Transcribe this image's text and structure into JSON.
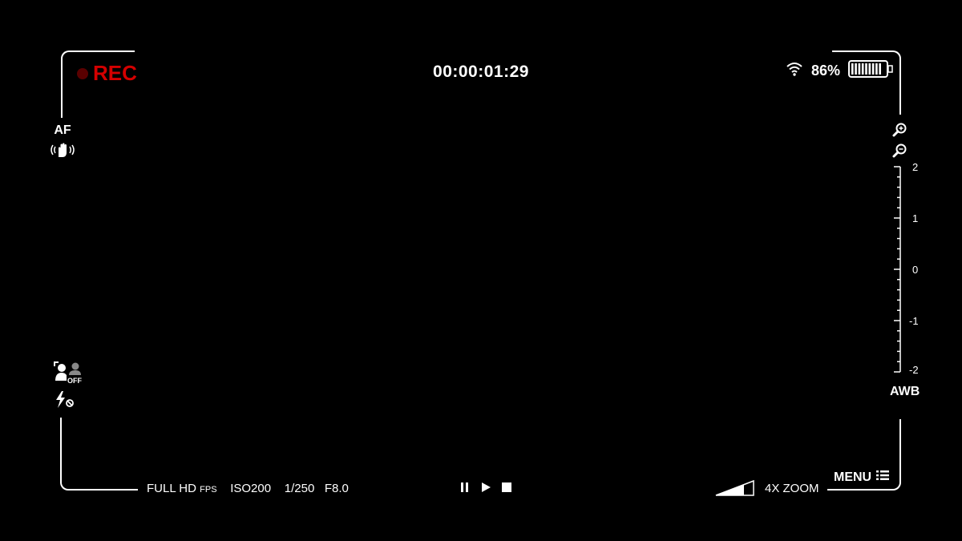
{
  "recording": {
    "label": "REC",
    "timecode": "00:00:01:29"
  },
  "status": {
    "battery_percent": "86%",
    "battery_level": 0.86,
    "wifi": "wifi-icon"
  },
  "focus": {
    "af_label": "AF",
    "stabilization_icon": "hand-stabilization-icon"
  },
  "exposure_scale": {
    "ticks": [
      "2",
      "1",
      "0",
      "-1",
      "-2"
    ]
  },
  "white_balance": {
    "label": "AWB"
  },
  "zoom": {
    "in_icon": "zoom-in-icon",
    "out_icon": "zoom-out-icon",
    "label": "4X ZOOM"
  },
  "face_detect": {
    "state": "OFF"
  },
  "flash": {
    "icon": "flash-off-icon"
  },
  "settings": {
    "resolution": "FULL HD",
    "fps_label": "FPS",
    "iso": "ISO200",
    "shutter": "1/250",
    "aperture": "F8.0"
  },
  "playback": {
    "pause_icon": "pause-icon",
    "play_icon": "play-icon",
    "stop_icon": "stop-icon"
  },
  "menu": {
    "label": "MENU"
  },
  "colors": {
    "rec_red": "#d40000",
    "rec_dot": "#5a0000",
    "foreground": "#ffffff",
    "background": "#000000"
  }
}
